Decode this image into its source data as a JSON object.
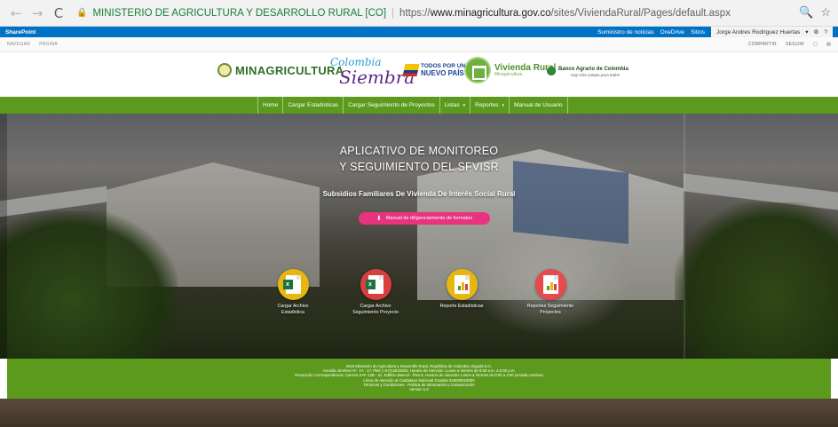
{
  "browser": {
    "back": "←",
    "forward": "→",
    "reload": "C",
    "site_label": "MINISTERIO DE AGRICULTURA Y DESARROLLO RURAL [CO]",
    "separator": "|",
    "url_scheme": "https://",
    "url_host": "www.minagricultura.gov.co",
    "url_path": "/sites/ViviendaRural/Pages/default.aspx",
    "zoom_glyph": "🔍",
    "star_glyph": "☆"
  },
  "suitebar": {
    "brand": "SharePoint",
    "links": [
      "Suministro de noticias",
      "OneDrive",
      "Sitios"
    ],
    "user": "Jorge Andres Rodriguez Huertas",
    "user_caret": "▾",
    "settings_glyph": "⚙",
    "help_glyph": "?"
  },
  "ribbon": {
    "tabs": [
      "NAVEGAR",
      "PÁGINA"
    ],
    "actions": [
      "COMPARTIR",
      "SEGUIR"
    ]
  },
  "header": {
    "ministry": "MINAGRICULTURA",
    "colombia_top": "Colombia",
    "colombia_main": "Siembra",
    "todos_line1": "TODOS POR UN",
    "todos_line2": "NUEVO PAÍS",
    "vivienda": "Vivienda Rural",
    "vivienda_sub": "Minagricultura",
    "banco": "Banco Agrario de Colombia",
    "banco_sub": "Hay más campo para todos"
  },
  "nav": {
    "items": [
      {
        "label": "Home"
      },
      {
        "label": "Cargar Estadísticas"
      },
      {
        "label": "Cargar Seguimiento de Proyectos"
      },
      {
        "label": "Listas",
        "caret": "▾"
      },
      {
        "label": "Reportes",
        "caret": "▾"
      },
      {
        "label": "Manual de Usuario"
      }
    ]
  },
  "hero": {
    "title_line1": "APLICATIVO DE MONITOREO",
    "title_line2": "Y SEGUIMIENTO DEL SFVISR",
    "subtitle": "Subsidios Familiares De Vivienda De Interés Social Rural",
    "manual_button": "Manual de diligenciamiento de formatos",
    "manual_icon": "⬇"
  },
  "actions": [
    {
      "line1": "Cargar Archivo",
      "line2": "Estadística",
      "color": "#e8b70f",
      "icon": "x"
    },
    {
      "line1": "Cargar Archivo",
      "line2": "Seguimiento Proyecto",
      "color": "#d93f3f",
      "icon": "x"
    },
    {
      "line1": "Reporte Estadísticas",
      "line2": "",
      "color": "#e8b70f",
      "icon": "chart"
    },
    {
      "line1": "Reportes Seguimiento",
      "line2": "Proyectos",
      "color": "#e64a4a",
      "icon": "chart"
    }
  ],
  "footer": {
    "lines": [
      "2015 Ministerio de Agricultura y Desarrollo Rural, República de Colombia, Bogotá D.C.",
      "Avenida Jiménez Nº. 7A - 17, PBX (+57)12543300, Horario de Atención: Lunes a Viernes de 8:00 a.m. a 5:00 p.m.",
      "Recepción Correspondencia: Carrera 8 Nº 12B - 31, Edificio Bancol - Piso 5, Horario de Atención: Lunes a Viernes de 8:00 a 4:00 jornada continua",
      "Línea de Atención al Ciudadano Nacional Gratuita 018000510050",
      "Términos y Condiciones - Política de Información y Comunicación",
      "Version 1.0"
    ]
  },
  "colors": {
    "green": "#5c9a1d",
    "sharepoint_blue": "#0072c6",
    "pink": "#e8347f"
  }
}
